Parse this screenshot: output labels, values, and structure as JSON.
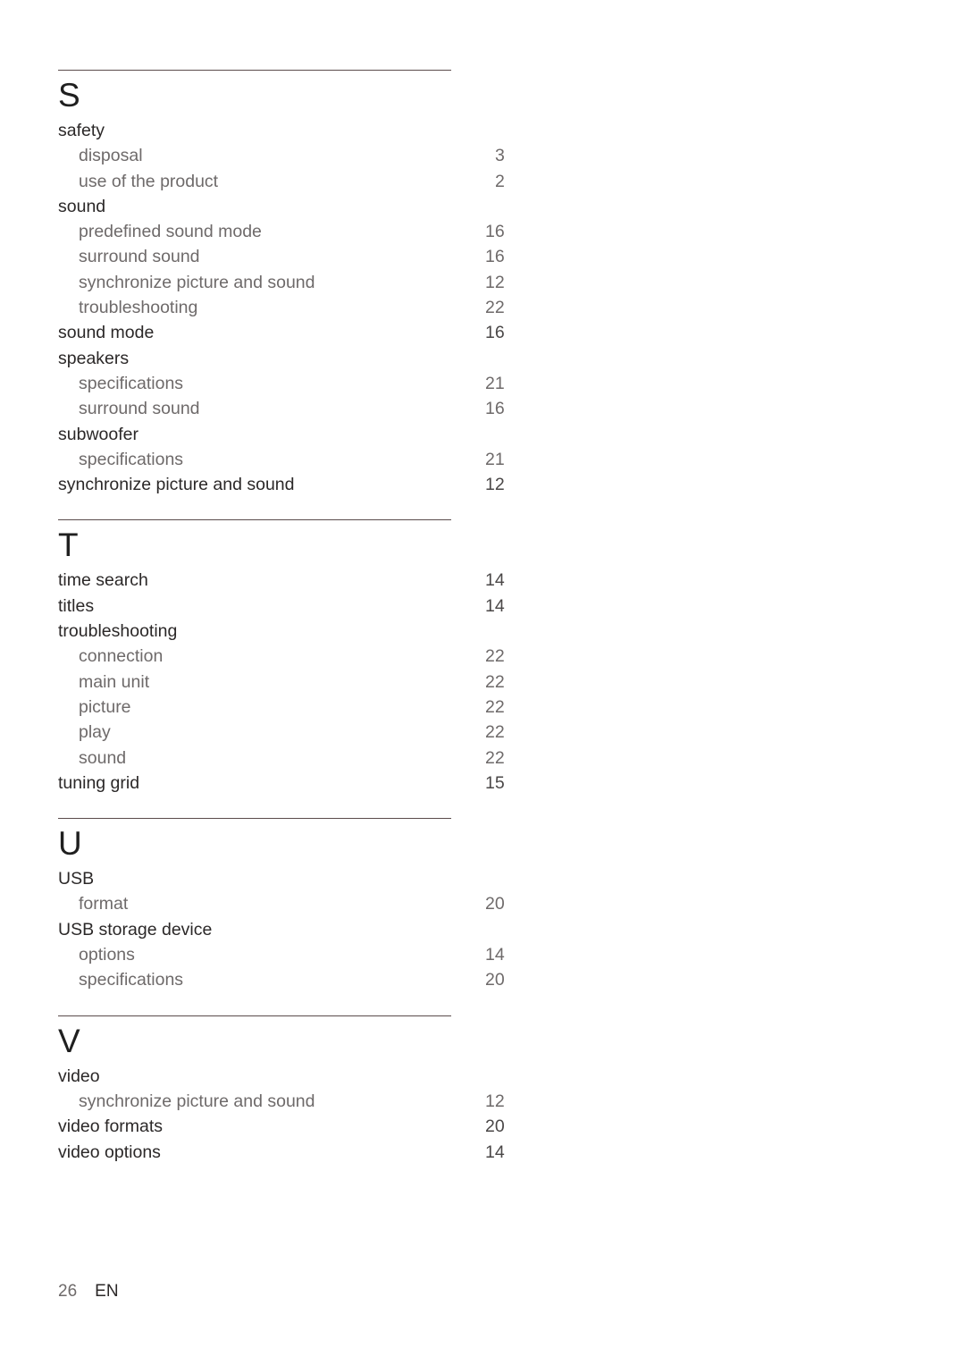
{
  "document": {
    "type": "index",
    "footer": {
      "page_number": "26",
      "language": "EN"
    }
  },
  "sections": [
    {
      "letter": "S",
      "entries": [
        {
          "label": "safety",
          "page": "",
          "level": 0
        },
        {
          "label": "disposal",
          "page": "3",
          "level": 1
        },
        {
          "label": "use of the product",
          "page": "2",
          "level": 1
        },
        {
          "label": "sound",
          "page": "",
          "level": 0
        },
        {
          "label": "predefined sound mode",
          "page": "16",
          "level": 1
        },
        {
          "label": "surround sound",
          "page": "16",
          "level": 1
        },
        {
          "label": "synchronize picture and sound",
          "page": "12",
          "level": 1
        },
        {
          "label": "troubleshooting",
          "page": "22",
          "level": 1
        },
        {
          "label": "sound mode",
          "page": "16",
          "level": 0
        },
        {
          "label": "speakers",
          "page": "",
          "level": 0
        },
        {
          "label": "specifications",
          "page": "21",
          "level": 1
        },
        {
          "label": "surround sound",
          "page": "16",
          "level": 1
        },
        {
          "label": "subwoofer",
          "page": "",
          "level": 0
        },
        {
          "label": "specifications",
          "page": "21",
          "level": 1
        },
        {
          "label": "synchronize picture and sound",
          "page": "12",
          "level": 0
        }
      ]
    },
    {
      "letter": "T",
      "entries": [
        {
          "label": "time search",
          "page": "14",
          "level": 0
        },
        {
          "label": "titles",
          "page": "14",
          "level": 0
        },
        {
          "label": "troubleshooting",
          "page": "",
          "level": 0
        },
        {
          "label": "connection",
          "page": "22",
          "level": 1
        },
        {
          "label": "main unit",
          "page": "22",
          "level": 1
        },
        {
          "label": "picture",
          "page": "22",
          "level": 1
        },
        {
          "label": "play",
          "page": "22",
          "level": 1
        },
        {
          "label": "sound",
          "page": "22",
          "level": 1
        },
        {
          "label": "tuning grid",
          "page": "15",
          "level": 0
        }
      ]
    },
    {
      "letter": "U",
      "entries": [
        {
          "label": "USB",
          "page": "",
          "level": 0
        },
        {
          "label": "format",
          "page": "20",
          "level": 1
        },
        {
          "label": "USB storage device",
          "page": "",
          "level": 0
        },
        {
          "label": "options",
          "page": "14",
          "level": 1
        },
        {
          "label": "specifications",
          "page": "20",
          "level": 1
        }
      ]
    },
    {
      "letter": "V",
      "entries": [
        {
          "label": "video",
          "page": "",
          "level": 0
        },
        {
          "label": "synchronize picture and sound",
          "page": "12",
          "level": 1
        },
        {
          "label": "video formats",
          "page": "20",
          "level": 0
        },
        {
          "label": "video options",
          "page": "14",
          "level": 0
        }
      ]
    }
  ]
}
